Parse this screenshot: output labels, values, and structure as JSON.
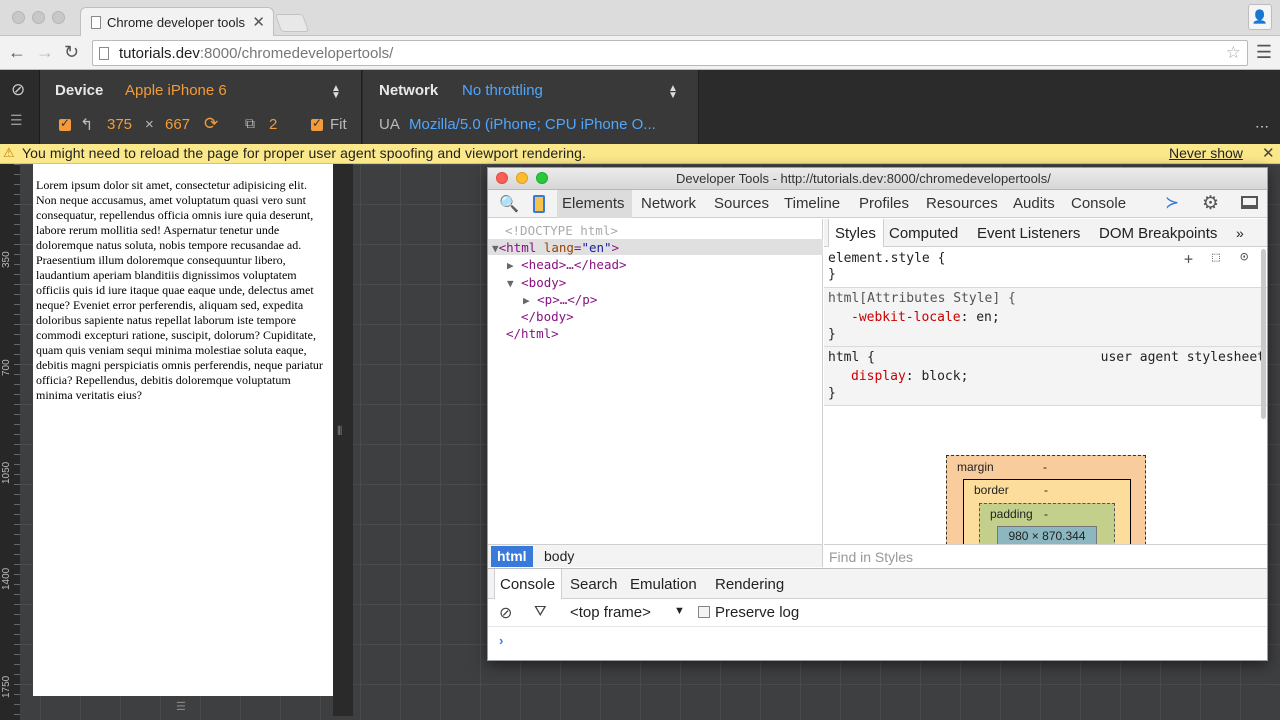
{
  "browser": {
    "tab_title": "Chrome developer tools",
    "url_host": "tutorials.dev",
    "url_rest": ":8000/chromedevelopertools/"
  },
  "emulation": {
    "device_label": "Device",
    "device_value": "Apple iPhone 6",
    "width": "375",
    "times": "×",
    "height": "667",
    "dpr": "2",
    "fit_label": "Fit",
    "network_label": "Network",
    "network_value": "No throttling",
    "ua_label": "UA",
    "ua_value": "Mozilla/5.0 (iPhone; CPU iPhone O..."
  },
  "warning": {
    "text": "You might need to reload the page for proper user agent spoofing and viewport rendering.",
    "never_show": "Never show"
  },
  "ruler": [
    "350",
    "700",
    "1050",
    "1400",
    "1750"
  ],
  "device_page": {
    "text": "Lorem ipsum dolor sit amet, consectetur adipisicing elit. Non neque accusamus, amet voluptatum quasi vero sunt consequatur, repellendus officia omnis iure quia deserunt, labore rerum mollitia sed! Aspernatur tenetur unde doloremque natus soluta, nobis tempore recusandae ad. Praesentium illum doloremque consequuntur libero, laudantium aperiam blanditiis dignissimos voluptatem officiis quis id iure itaque quae eaque unde, delectus amet neque? Eveniet error perferendis, aliquam sed, expedita doloribus sapiente natus repellat laborum iste tempore commodi excepturi ratione, suscipit, dolorum? Cupiditate, quam quis veniam sequi minima molestiae soluta eaque, debitis magni perspiciatis omnis perferendis, neque pariatur officia? Repellendus, debitis doloremque voluptatum minima veritatis eius?"
  },
  "devtools": {
    "title": "Developer Tools - http://tutorials.dev:8000/chromedevelopertools/",
    "tabs": [
      "Elements",
      "Network",
      "Sources",
      "Timeline",
      "Profiles",
      "Resources",
      "Audits",
      "Console"
    ],
    "dom": {
      "doctype": "<!DOCTYPE html>",
      "html_open": "<html",
      "lang_attr": "lang",
      "lang_val": "\"en\"",
      "gt": ">",
      "head": "<head>…</head>",
      "body_open": "<body>",
      "p": "<p>…</p>",
      "body_close": "</body>",
      "html_close": "</html>"
    },
    "breadcrumbs": [
      "html",
      "body"
    ],
    "styles_tabs": [
      "Styles",
      "Computed",
      "Event Listeners",
      "DOM Breakpoints"
    ],
    "rules": {
      "element_style": "element.style {",
      "brace_close": "}",
      "attr_style": "html[Attributes Style] {",
      "prop1_name": "-webkit-locale",
      "prop1_value": ": en;",
      "html_rule": "html {",
      "ua_stylesheet": "user agent stylesheet",
      "prop2_name": "display",
      "prop2_value": ": block;"
    },
    "box_model": {
      "margin": "margin",
      "border": "border",
      "padding": "padding",
      "dash": "-",
      "content": "980 × 870.344"
    },
    "find_placeholder": "Find in Styles",
    "drawer_tabs": [
      "Console",
      "Search",
      "Emulation",
      "Rendering"
    ],
    "frame_select": "<top frame>",
    "preserve_log": "Preserve log",
    "prompt": "›"
  }
}
